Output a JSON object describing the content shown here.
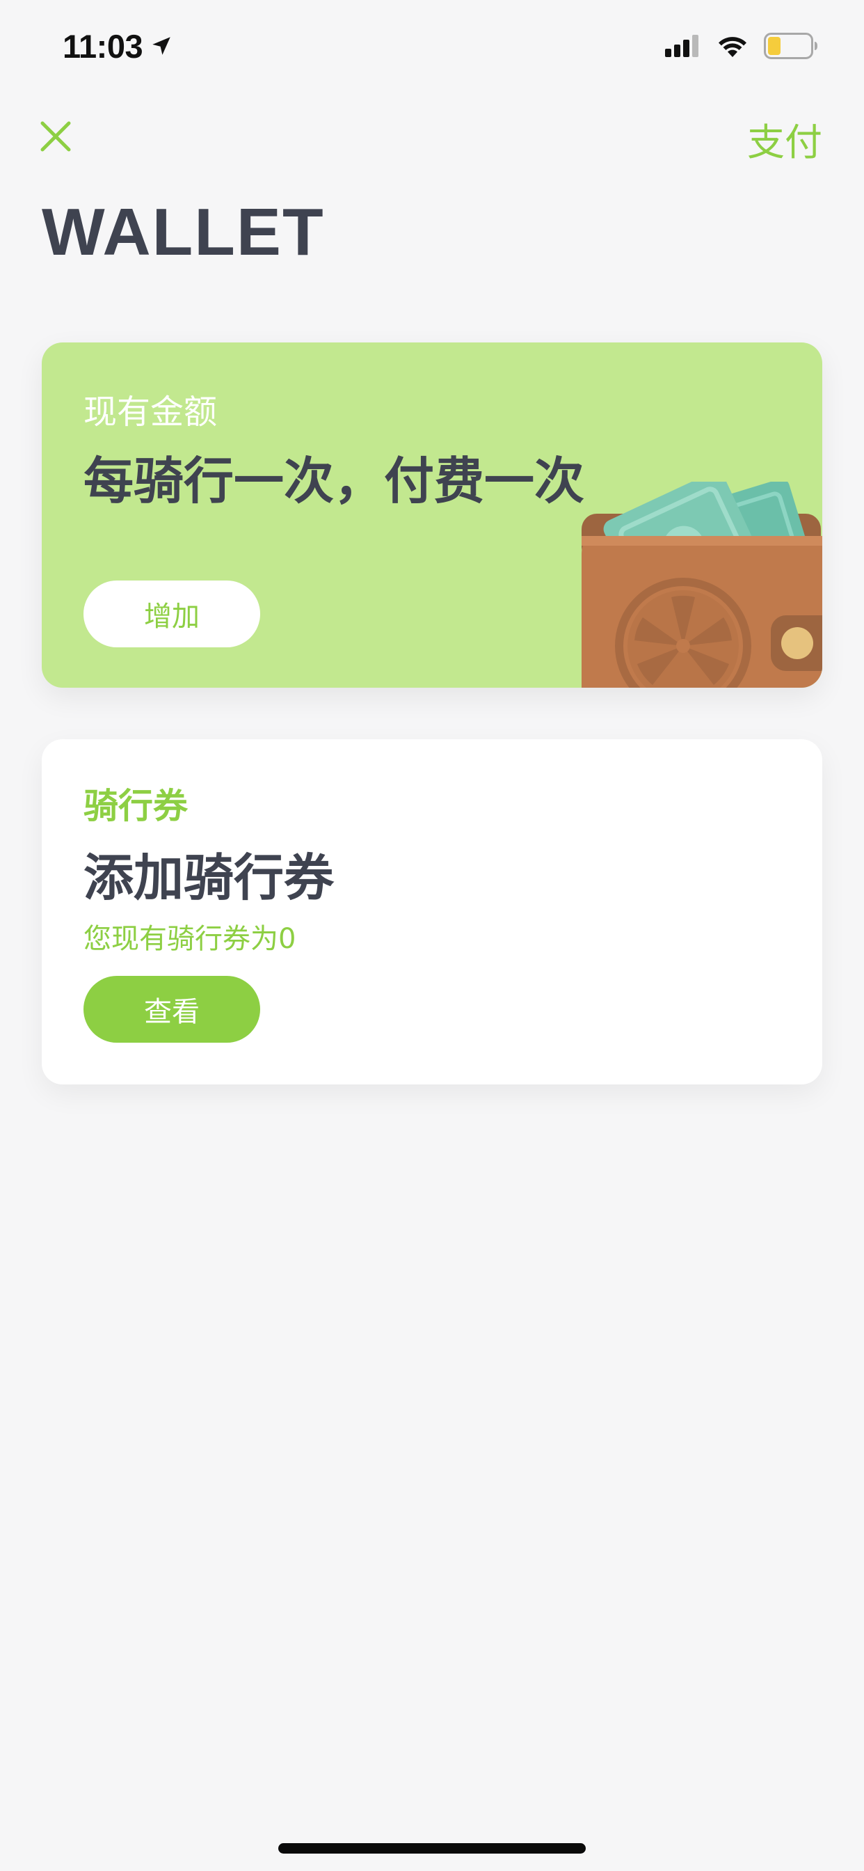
{
  "status_bar": {
    "time": "11:03",
    "location_icon": "location-arrow-icon",
    "signal_icon": "cellular-signal-icon",
    "wifi_icon": "wifi-icon",
    "battery_icon": "battery-low-icon",
    "battery_level": 0.25
  },
  "nav": {
    "close_icon": "close-icon",
    "pay_label": "支付"
  },
  "page": {
    "title": "WALLET"
  },
  "balance_card": {
    "label": "现有金额",
    "headline": "每骑行一次，付费一次",
    "add_button_label": "增加",
    "illustration_icon": "wallet-icon"
  },
  "coupon_card": {
    "label": "骑行券",
    "headline": "添加骑行券",
    "count_text": "您现有骑行券为0",
    "view_button_label": "查看"
  },
  "colors": {
    "accent": "#8dcf43",
    "balance_card_bg": "#c2e88f",
    "text_dark": "#3f4350",
    "background": "#f6f6f7"
  }
}
